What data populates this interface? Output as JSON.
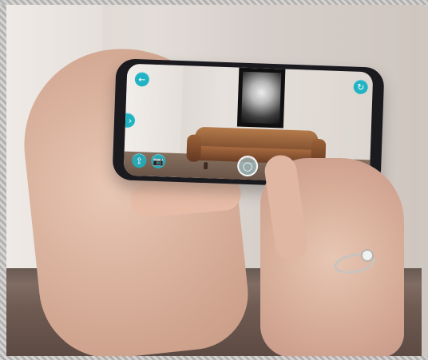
{
  "scene": {
    "phone": {
      "screen": {
        "buttons": [
          {
            "name": "back-button",
            "icon": "arrow-left-icon"
          },
          {
            "name": "side-handle-button",
            "icon": "chevron-right-icon"
          },
          {
            "name": "rotate-button",
            "icon": "rotate-icon"
          },
          {
            "name": "share-button",
            "icon": "share-icon"
          },
          {
            "name": "camera-button",
            "icon": "camera-icon"
          },
          {
            "name": "place-button",
            "icon": "circle-icon"
          },
          {
            "name": "close-button",
            "icon": "close-icon"
          },
          {
            "name": "trash-button",
            "icon": "trash-icon"
          }
        ]
      }
    }
  }
}
